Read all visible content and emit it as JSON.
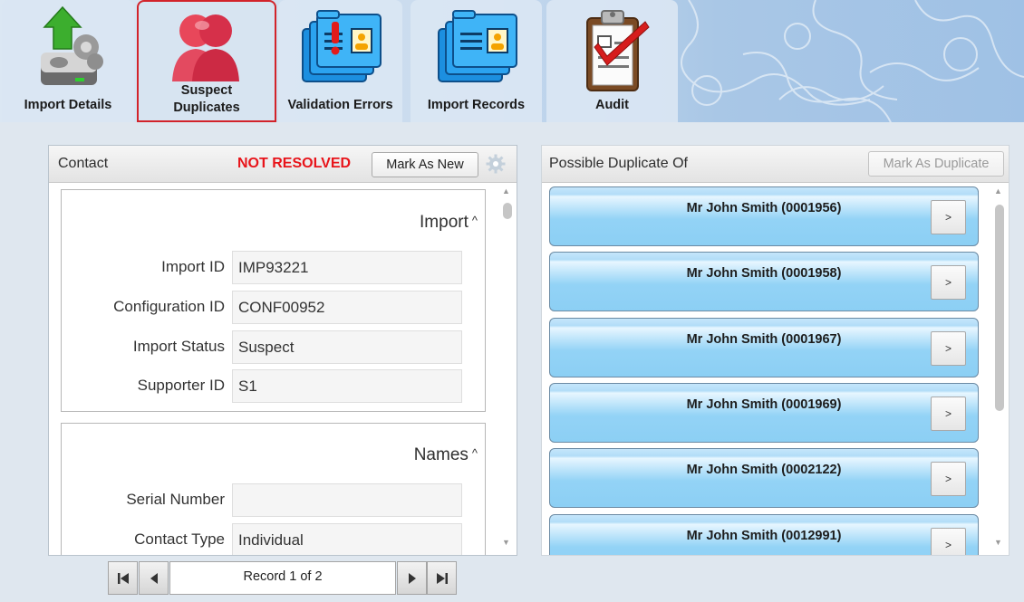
{
  "tabs": [
    {
      "label": "Import Details",
      "icon": "import-details-icon"
    },
    {
      "label": "Suspect Duplicates",
      "icon": "suspect-duplicates-icon"
    },
    {
      "label": "Validation Errors",
      "icon": "validation-errors-icon"
    },
    {
      "label": "Import Records",
      "icon": "import-records-icon"
    },
    {
      "label": "Audit",
      "icon": "audit-clipboard-icon"
    }
  ],
  "active_tab": "Suspect Duplicates",
  "contact_panel": {
    "title": "Contact",
    "status": "NOT RESOLVED",
    "status_color": "#e8141a",
    "mark_new_label": "Mark As New",
    "sections": [
      {
        "title": "Import",
        "fields": [
          {
            "label": "Import ID",
            "value": "IMP93221"
          },
          {
            "label": "Configuration ID",
            "value": "CONF00952"
          },
          {
            "label": "Import Status",
            "value": "Suspect"
          },
          {
            "label": "Supporter ID",
            "value": "S1"
          }
        ]
      },
      {
        "title": "Names",
        "fields": [
          {
            "label": "Serial Number",
            "value": ""
          },
          {
            "label": "Contact Type",
            "value": "Individual"
          }
        ]
      }
    ]
  },
  "pager": {
    "text": "Record 1 of 2"
  },
  "duplicates_panel": {
    "title": "Possible Duplicate Of",
    "mark_duplicate_label": "Mark As Duplicate",
    "items": [
      {
        "name": "Mr John Smith  (0001956)",
        "button": ">"
      },
      {
        "name": "Mr John Smith  (0001958)",
        "button": ">"
      },
      {
        "name": "Mr John Smith  (0001967)",
        "button": ">"
      },
      {
        "name": "Mr John Smith  (0001969)",
        "button": ">"
      },
      {
        "name": "Mr John Smith  (0002122)",
        "button": ">"
      },
      {
        "name": "Mr John Smith  (0012991)",
        "button": ">"
      }
    ]
  }
}
